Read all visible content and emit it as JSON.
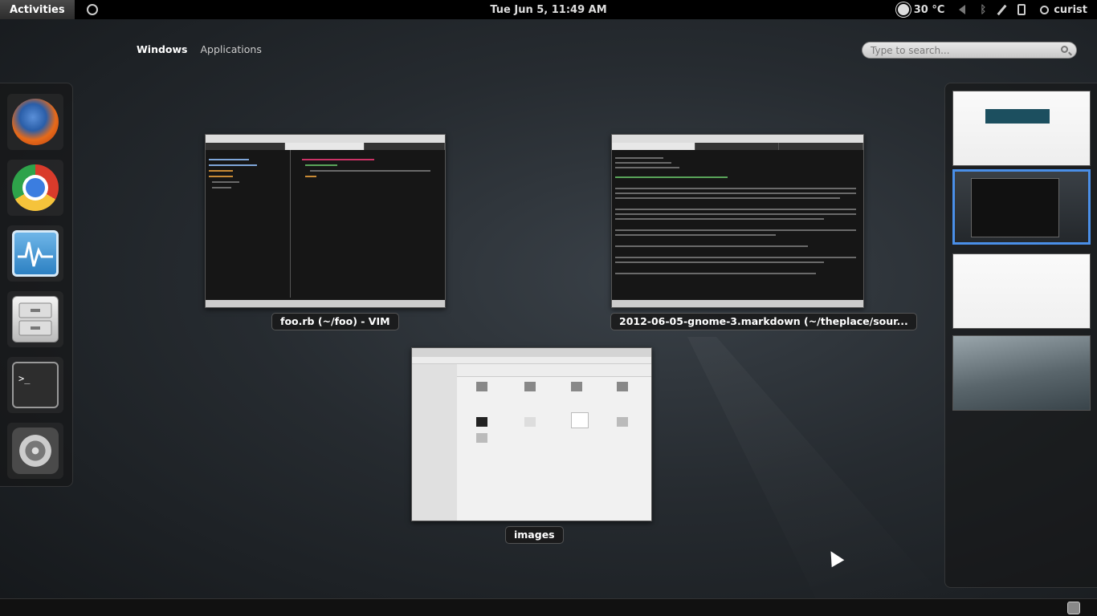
{
  "topbar": {
    "activities_label": "Activities",
    "clock": "Tue Jun  5, 11:49 AM",
    "temperature": "30 °C",
    "user": "curist"
  },
  "overview": {
    "tabs": [
      {
        "label": "Windows",
        "active": true
      },
      {
        "label": "Applications",
        "active": false
      }
    ],
    "search_placeholder": "Type to search..."
  },
  "dash": {
    "apps": [
      "firefox-icon",
      "chrome-icon",
      "system-monitor-icon",
      "file-cabinet-icon",
      "terminal-icon",
      "system-settings-icon"
    ],
    "terminal_glyph": ">_"
  },
  "windows": [
    {
      "caption": "foo.rb (~/foo) - VIM"
    },
    {
      "caption": "2012-06-05-gnome-3.markdown (~/theplace/sour..."
    },
    {
      "caption": "images"
    }
  ],
  "workspaces": {
    "count": 4,
    "active_index": 1
  },
  "colors": {
    "accent": "#4a8fe8",
    "topbar": "#000000"
  }
}
